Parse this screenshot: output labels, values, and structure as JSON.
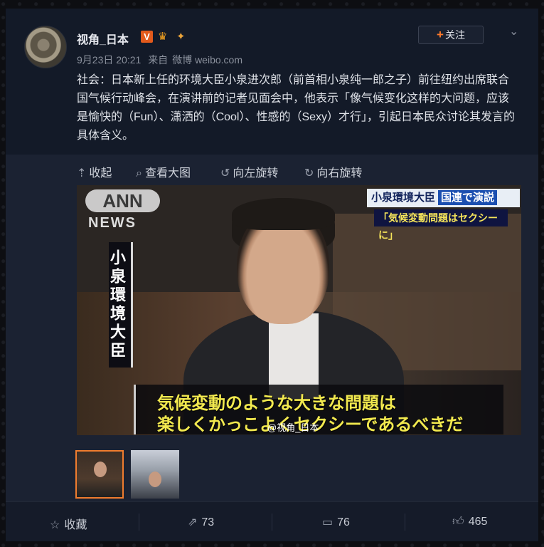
{
  "post": {
    "author": "视角_日本",
    "verified_badge": "V",
    "follow_label": "关注",
    "follow_plus": "+",
    "timestamp": "9月23日 20:21",
    "source_prefix": "来自",
    "source_name": "微博 weibo.com",
    "text": "社会：日本新上任的环境大臣小泉进次郎（前首相小泉纯一郎之子）前往纽约出席联合国气候行动峰会，在演讲前的记者见面会中，他表示「像气候变化这样的大问题，应该是愉快的（Fun）、潇洒的（Cool）、性感的（Sexy）才行」，引起日本民众讨论其发言的具体含义。"
  },
  "media_toolbar": {
    "collapse_label": "收起",
    "view_large_label": "查看大图",
    "rotate_left_label": "向左旋转",
    "rotate_right_label": "向右旋转"
  },
  "image": {
    "logo_text": "ANN",
    "logo_sub": "NEWS",
    "vertical_caption": "小泉環境大臣",
    "top_caption_name": "小泉環境大臣",
    "top_caption_event": "国連で演説",
    "top_caption_quote": "「気候変動問題はセクシーに」",
    "subtitle_line_1": "気候変動のような大きな問題は",
    "subtitle_line_2": "楽しくかっこよくセクシーであるべきだ",
    "watermark": "@视角_日本"
  },
  "actions": {
    "favorite_label": "收藏",
    "repost_count": "73",
    "comment_count": "76",
    "like_count": "465"
  },
  "colors": {
    "accent": "#f07c2e",
    "background": "#151b29",
    "subtitle_yellow": "#f2e94f"
  }
}
